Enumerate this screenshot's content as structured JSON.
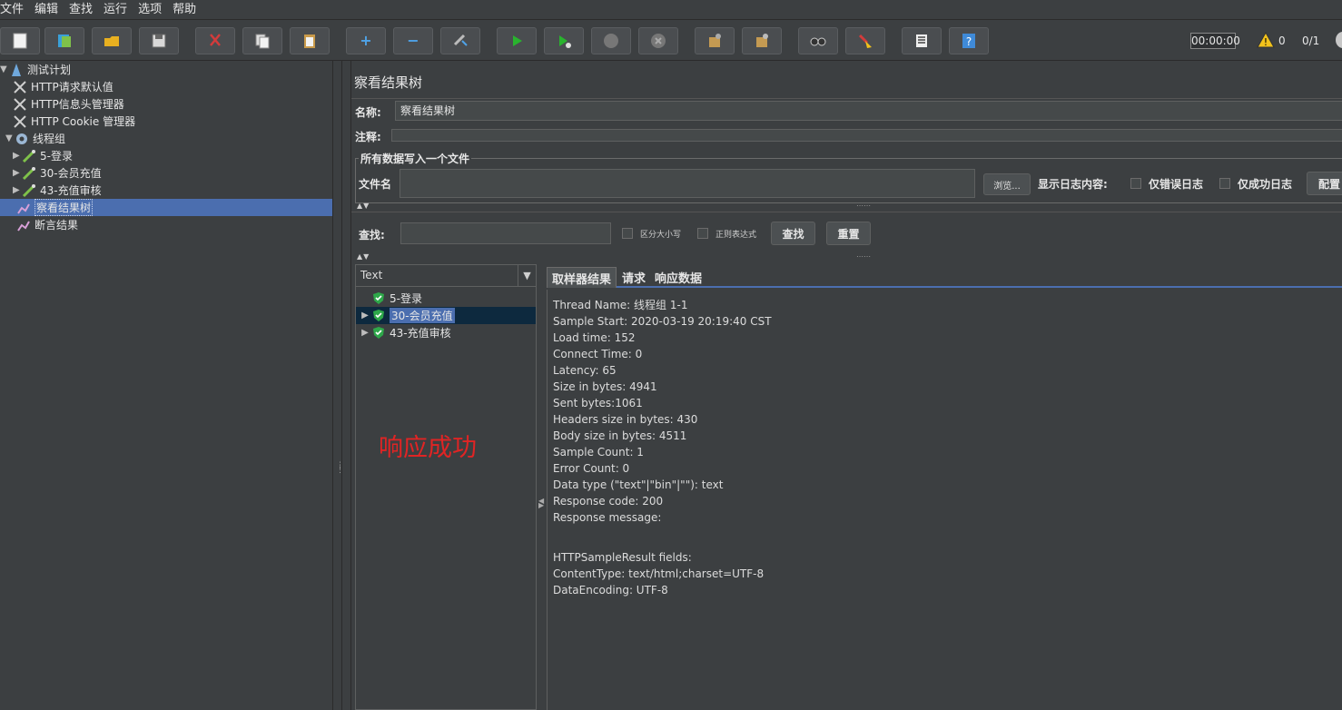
{
  "menu": [
    "文件",
    "编辑",
    "查找",
    "运行",
    "选项",
    "帮助"
  ],
  "toolbar": {
    "timer": "00:00:00",
    "warning_count": "0",
    "thread_count": "0/1",
    "colors": {
      "green": "#29b32e",
      "red": "#d33b3b",
      "blue": "#3f8ad8"
    }
  },
  "tree": {
    "items": [
      {
        "label": "测试计划",
        "icon": "test-plan-icon"
      },
      {
        "label": "HTTP请求默认值",
        "icon": "wrench-icon"
      },
      {
        "label": "HTTP信息头管理器",
        "icon": "wrench-icon"
      },
      {
        "label": "HTTP Cookie 管理器",
        "icon": "wrench-icon"
      },
      {
        "label": "线程组",
        "icon": "gear-icon"
      },
      {
        "label": "5-登录",
        "icon": "pipette-icon"
      },
      {
        "label": "30-会员充值",
        "icon": "pipette-icon"
      },
      {
        "label": "43-充值审核",
        "icon": "pipette-icon"
      },
      {
        "label": "察看结果树",
        "icon": "chart-icon"
      },
      {
        "label": "断言结果",
        "icon": "chart-icon"
      }
    ]
  },
  "panel": {
    "title": "察看结果树",
    "name_label": "名称:",
    "name_value": "察看结果树",
    "comment_label": "注释:",
    "fieldset_title": "所有数据写入一个文件",
    "file_label": "文件名",
    "browse_label": "浏览...",
    "log_label": "显示日志内容:",
    "errors_only_label": "仅错误日志",
    "success_only_label": "仅成功日志",
    "config_label": "配置",
    "search_label": "查找:",
    "case_label": "区分大小写",
    "regex_label": "正则表达式",
    "find_button": "查找",
    "reset_button": "重置"
  },
  "results": {
    "renderer": "Text",
    "items": [
      {
        "label": "5-登录"
      },
      {
        "label": "30-会员充值"
      },
      {
        "label": "43-充值审核"
      }
    ],
    "annotation": "响应成功"
  },
  "tabs": [
    "取样器结果",
    "请求",
    "响应数据"
  ],
  "detail": {
    "lines": [
      "Thread Name: 线程组 1-1",
      "Sample Start: 2020-03-19 20:19:40 CST",
      "Load time: 152",
      "Connect Time: 0",
      "Latency: 65",
      "Size in bytes: 4941",
      "Sent bytes:1061",
      "Headers size in bytes: 430",
      "Body size in bytes: 4511",
      "Sample Count: 1",
      "Error Count: 0",
      "Data type (\"text\"|\"bin\"|\"\"): text",
      "Response code: 200",
      "Response message: ",
      "",
      "",
      "HTTPSampleResult fields:",
      "ContentType: text/html;charset=UTF-8",
      "DataEncoding: UTF-8"
    ]
  }
}
